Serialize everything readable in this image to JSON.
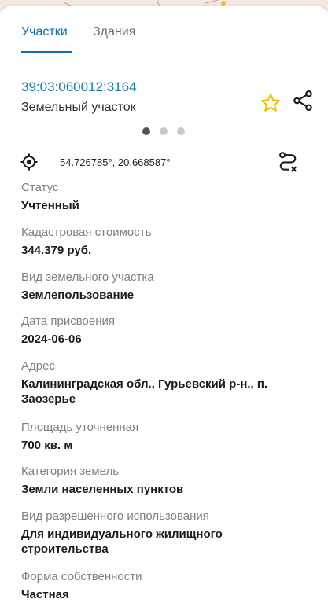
{
  "tabs": [
    {
      "label": "Участки",
      "active": true
    },
    {
      "label": "Здания",
      "active": false
    }
  ],
  "parcel": {
    "cadastral_number": "39:03:060012:3164",
    "type": "Земельный участок"
  },
  "pager": {
    "count": 3,
    "active": 0
  },
  "coordinates": "54.726785°, 20.668587°",
  "fields": [
    {
      "label": "Статус",
      "value": "Учтенный"
    },
    {
      "label": "Кадастровая стоимость",
      "value": "344.379 руб."
    },
    {
      "label": "Вид земельного участка",
      "value": "Землепользование"
    },
    {
      "label": "Дата присвоения",
      "value": "2024-06-06"
    },
    {
      "label": "Адрес",
      "value": "Калининградская обл., Гурьевский р-н., п. Заозерье"
    },
    {
      "label": "Площадь уточненная",
      "value": "700 кв. м"
    },
    {
      "label": "Категория земель",
      "value": "Земли населенных пунктов"
    },
    {
      "label": "Вид разрешенного использования",
      "value": "Для индивидуального жилищного строительства"
    },
    {
      "label": "Форма собственности",
      "value": "Частная"
    }
  ],
  "colors": {
    "accent": "#0f6fa8",
    "star": "#f2c200"
  },
  "icons": {
    "favorite": "star-icon",
    "share": "share-icon",
    "locate": "target-icon",
    "route": "route-icon"
  }
}
